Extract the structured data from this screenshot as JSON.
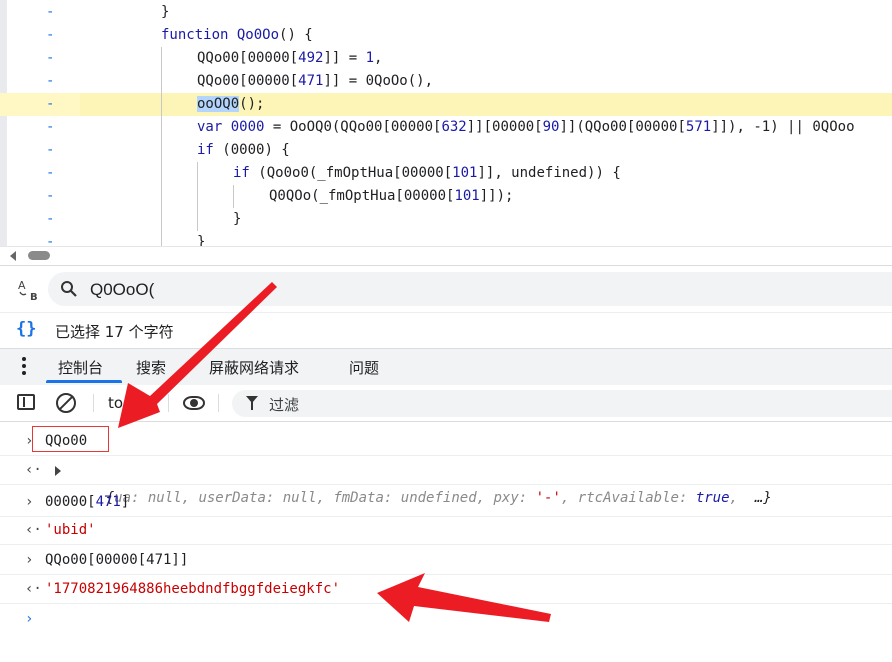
{
  "code_lines": [
    {
      "parts": [
        {
          "t": "}",
          "c": ""
        }
      ]
    },
    {
      "parts": [
        {
          "t": "function ",
          "c": "kw"
        },
        {
          "t": "Qo0Oo",
          "c": "fn"
        },
        {
          "t": "() {",
          "c": ""
        }
      ]
    },
    {
      "parts": [
        {
          "t": "QQo00[00000[",
          "c": ""
        },
        {
          "t": "492",
          "c": "num"
        },
        {
          "t": "]] = ",
          "c": ""
        },
        {
          "t": "1",
          "c": "num"
        },
        {
          "t": ",",
          "c": ""
        }
      ]
    },
    {
      "parts": [
        {
          "t": "QQo00[00000[",
          "c": ""
        },
        {
          "t": "471",
          "c": "num"
        },
        {
          "t": "]] = 0QoOo(),",
          "c": ""
        }
      ]
    },
    {
      "parts": [
        {
          "t": "ooOQ0",
          "c": "sel"
        },
        {
          "t": "();",
          "c": ""
        }
      ]
    },
    {
      "parts": [
        {
          "t": "var ",
          "c": "kw"
        },
        {
          "t": "0000",
          "c": "num"
        },
        {
          "t": " = OoOQ0(QQo00[00000[",
          "c": ""
        },
        {
          "t": "632",
          "c": "num"
        },
        {
          "t": "]][00000[",
          "c": ""
        },
        {
          "t": "90",
          "c": "num"
        },
        {
          "t": "]](QQo00[00000[",
          "c": ""
        },
        {
          "t": "571",
          "c": "num"
        },
        {
          "t": "]]), -1) || 0QOoo",
          "c": ""
        }
      ]
    },
    {
      "parts": [
        {
          "t": "if ",
          "c": "kw"
        },
        {
          "t": "(0000) {",
          "c": ""
        }
      ]
    },
    {
      "parts": [
        {
          "t": "if ",
          "c": "kw"
        },
        {
          "t": "(Qo0o0(_fmOptHua[00000[",
          "c": ""
        },
        {
          "t": "101",
          "c": "num"
        },
        {
          "t": "]], undefined)) {",
          "c": ""
        }
      ]
    },
    {
      "parts": [
        {
          "t": "Q0QOo(_fmOptHua[00000[",
          "c": ""
        },
        {
          "t": "101",
          "c": "num"
        },
        {
          "t": "]]);",
          "c": ""
        }
      ]
    },
    {
      "parts": [
        {
          "t": "}",
          "c": ""
        }
      ]
    },
    {
      "parts": [
        {
          "t": "}",
          "c": ""
        }
      ]
    }
  ],
  "gutter_marker": "-",
  "search": {
    "value": "Q0OoO("
  },
  "selection_status": "已选择 17 个字符",
  "drawer_tabs": [
    "控制台",
    "搜索",
    "屏蔽网络请求",
    "问题"
  ],
  "console_toolbar": {
    "context": "to",
    "filter_label": "过滤"
  },
  "console": {
    "input1": "QQo00",
    "output1": {
      "open": "{",
      "entries": [
        {
          "key": "ua",
          "value": "null",
          "kind": "null"
        },
        {
          "key": "userData",
          "value": "null",
          "kind": "null"
        },
        {
          "key": "fmData",
          "value": "undefined",
          "kind": "null"
        },
        {
          "key": "pxy",
          "value": "'-'",
          "kind": "str"
        },
        {
          "key": "rtcAvailable",
          "value": "true",
          "kind": "bool"
        }
      ],
      "more": "…",
      "close": "}"
    },
    "input2_prefix": "00000[",
    "input2_num": "471",
    "input2_suffix": "]",
    "output2": "'ubid'",
    "input3": "QQo00[00000[471]]",
    "output3": "'1770821964886heebdndfbggfdeiegkfc'"
  },
  "colors": {
    "accent": "#1a73e8",
    "annotation": "#e53935",
    "string": "#c80000",
    "highlight": "#fdf5b8"
  },
  "icons": [
    "case-sensitive-icon",
    "search-icon",
    "braces-icon",
    "menu-icon",
    "sidebar-toggle-icon",
    "clear-console-icon",
    "eye-icon",
    "filter-icon"
  ]
}
